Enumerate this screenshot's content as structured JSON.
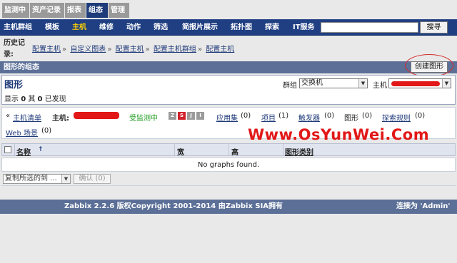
{
  "top_tabs": [
    "监测中",
    "资产记录",
    "报表",
    "组态",
    "管理"
  ],
  "sub_nav": [
    "主机群组",
    "模板",
    "主机",
    "维修",
    "动作",
    "筛选",
    "简报片展示",
    "拓扑图",
    "探索",
    "IT服务"
  ],
  "search": {
    "value": "",
    "button": "搜寻"
  },
  "history_label": "历史记录:",
  "breadcrumbs": [
    "配置主机",
    "自定义图表",
    "配置主机",
    "配置主机群组",
    "配置主机"
  ],
  "conf_header": {
    "title": "图形的组态",
    "create_button": "创建图形"
  },
  "panel": {
    "title": "图形",
    "group_label": "群组",
    "group_value": "交换机",
    "host_label": "主机",
    "found_display": "显示",
    "found_n1": "0",
    "found_of": "其",
    "found_n2": "0",
    "found_tail": "已发现"
  },
  "hostinfo": {
    "host_list_link": "主机清单",
    "host_label": "主机:",
    "status": "受监测中",
    "badges": [
      "Z",
      "S",
      "J",
      "I"
    ],
    "badge_colors": [
      "#9b9b9b",
      "#d0202a",
      "#9b9b9b",
      "#9b9b9b"
    ],
    "apps": {
      "label": "应用集",
      "count": "(0)"
    },
    "items": {
      "label": "项目",
      "count": "(1)"
    },
    "triggers": {
      "label": "触发器",
      "count": "(0)"
    },
    "graphs": {
      "label": "图形",
      "count": "(0)"
    },
    "discovery": {
      "label": "探索规则",
      "count": "(0)"
    },
    "web": {
      "label": "Web 场景",
      "count": "(0)"
    }
  },
  "table": {
    "headers": [
      "名称",
      "宽",
      "高",
      "图形类别"
    ],
    "sort_icon": "↑",
    "empty": "No graphs found."
  },
  "actions": {
    "select_placeholder": "复制所选的到 ...",
    "confirm": "确认 (0)"
  },
  "footer": {
    "copyright": "Zabbix 2.2.6 版权Copyright 2001-2014 由Zabbix SIA拥有",
    "user": "连接为 'Admin'"
  },
  "watermark": "Www.OsYunWei.Com",
  "colors": {
    "nav": "#1f3f82",
    "header_bar": "#5b6f97",
    "active_nav": "#ffd200",
    "monitored": "#1b9a1b",
    "watermark": "#e21818"
  }
}
